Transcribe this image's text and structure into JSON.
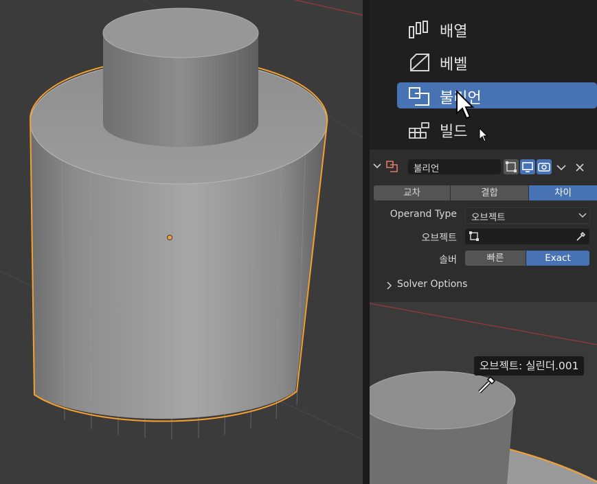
{
  "menu": {
    "items": [
      {
        "label": "배열",
        "icon": "array-icon",
        "active": false
      },
      {
        "label": "베벨",
        "icon": "bevel-icon",
        "active": false
      },
      {
        "label": "불리언",
        "icon": "boolean-icon",
        "active": true
      },
      {
        "label": "빌드",
        "icon": "build-icon",
        "active": false
      }
    ]
  },
  "modifier": {
    "name": "불리언",
    "operations": [
      "교차",
      "결합",
      "차이"
    ],
    "active_operation": "차이",
    "operand_type_label": "Operand Type",
    "operand_type_value": "오브젝트",
    "object_label": "오브젝트",
    "object_value": "",
    "solver_label": "솔버",
    "solver_options": [
      "빠른",
      "Exact"
    ],
    "active_solver": "Exact",
    "solver_options_panel": "Solver Options"
  },
  "tooltip": {
    "text": "오브젝트: 실린더.001"
  },
  "colors": {
    "accent": "#4772b3",
    "selection_outline": "#f5a030",
    "panel_bg": "#2d2d2d",
    "menu_bg": "#1f1f1f"
  }
}
